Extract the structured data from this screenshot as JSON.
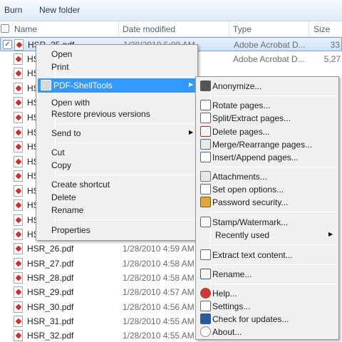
{
  "toolbar": {
    "burn": "Burn",
    "new_folder": "New folder"
  },
  "columns": {
    "name": "Name",
    "date": "Date modified",
    "type": "Type",
    "size": "Size"
  },
  "rows": [
    {
      "name": "HSR_25.pdf",
      "date": "1/28/2010 5:00 AM",
      "type": "Adobe Acrobat D...",
      "size": "33"
    },
    {
      "name": "HS",
      "date": "",
      "type": "Adobe Acrobat D...",
      "size": "5,27"
    },
    {
      "name": "HS",
      "date": "",
      "type": "",
      "size": ""
    },
    {
      "name": "HSR",
      "date": "",
      "type": "",
      "size": ""
    },
    {
      "name": "HS",
      "date": "",
      "type": "",
      "size": ""
    },
    {
      "name": "HS",
      "date": "",
      "type": "",
      "size": ""
    },
    {
      "name": "HS",
      "date": "",
      "type": "",
      "size": ""
    },
    {
      "name": "HS",
      "date": "",
      "type": "",
      "size": ""
    },
    {
      "name": "HS",
      "date": "",
      "type": "",
      "size": ""
    },
    {
      "name": "HS",
      "date": "",
      "type": "",
      "size": ""
    },
    {
      "name": "HS",
      "date": "",
      "type": "",
      "size": ""
    },
    {
      "name": "HS",
      "date": "",
      "type": "",
      "size": ""
    },
    {
      "name": "HS",
      "date": "",
      "type": "",
      "size": ""
    },
    {
      "name": "HS",
      "date": "",
      "type": "",
      "size": ""
    },
    {
      "name": "HS",
      "date": "",
      "type": "",
      "size": ""
    },
    {
      "name": "HSR",
      "date": "",
      "type": "",
      "size": ""
    },
    {
      "name": "HSR_26.pdf",
      "date": "1/28/2010 4:59 AM",
      "type": "",
      "size": ""
    },
    {
      "name": "HSR_27.pdf",
      "date": "1/28/2010 4:58 AM",
      "type": "",
      "size": ""
    },
    {
      "name": "HSR_28.pdf",
      "date": "1/28/2010 4:58 AM",
      "type": "",
      "size": ""
    },
    {
      "name": "HSR_29.pdf",
      "date": "1/28/2010 4:57 AM",
      "type": "",
      "size": ""
    },
    {
      "name": "HSR_30.pdf",
      "date": "1/28/2010 4:56 AM",
      "type": "",
      "size": ""
    },
    {
      "name": "HSR_31.pdf",
      "date": "1/28/2010 4:55 AM",
      "type": "",
      "size": ""
    },
    {
      "name": "HSR_32.pdf",
      "date": "1/28/2010 4:55 AM",
      "type": "",
      "size": ""
    }
  ],
  "context_menu": {
    "open": "Open",
    "print": "Print",
    "pdf_shelltools": "PDF-ShellTools",
    "open_with": "Open with",
    "restore": "Restore previous versions",
    "send_to": "Send to",
    "cut": "Cut",
    "copy": "Copy",
    "create_shortcut": "Create shortcut",
    "delete": "Delete",
    "rename": "Rename",
    "properties": "Properties"
  },
  "submenu": {
    "anonymize": "Anonymize...",
    "rotate": "Rotate pages...",
    "split": "Split/Extract pages...",
    "delete_pages": "Delete pages...",
    "merge": "Merge/Rearrange pages...",
    "insert": "Insert/Append pages...",
    "attachments": "Attachments...",
    "open_options": "Set open options...",
    "password": "Password security...",
    "stamp": "Stamp/Watermark...",
    "recently_used": "Recently used",
    "extract_text": "Extract text content...",
    "rename": "Rename...",
    "help": "Help...",
    "settings": "Settings...",
    "updates": "Check for updates...",
    "about": "About..."
  },
  "icons": {
    "anonymize": "mask-icon",
    "rotate": "rotate-pages-icon",
    "split": "split-pages-icon",
    "delete_pages": "delete-pages-icon",
    "merge": "merge-pages-icon",
    "insert": "insert-pages-icon",
    "attachments": "paperclip-icon",
    "open_options": "open-options-icon",
    "password": "lock-icon",
    "stamp": "stamp-icon",
    "extract_text": "extract-text-icon",
    "rename": "rename-icon",
    "help": "help-icon",
    "settings": "settings-icon",
    "updates": "update-icon",
    "about": "info-icon"
  },
  "colors": {
    "highlight": "#3399ff",
    "selected_row": "#cfe3fb",
    "menu_bg": "#f0f0f0"
  }
}
